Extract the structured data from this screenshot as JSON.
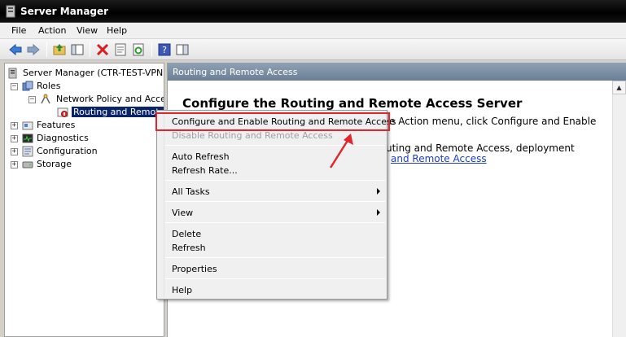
{
  "window": {
    "title": "Server Manager"
  },
  "menubar": {
    "items": [
      "File",
      "Action",
      "View",
      "Help"
    ]
  },
  "tree": {
    "root": "Server Manager (CTR-TEST-VPN)",
    "roles": "Roles",
    "npa": "Network Policy and Access",
    "rra": "Routing and Remote Ac",
    "features": "Features",
    "diagnostics": "Diagnostics",
    "configuration": "Configuration",
    "storage": "Storage"
  },
  "right": {
    "header": "Routing and Remote Access",
    "heading": "Configure the Routing and Remote Access Server",
    "line1": "e Action menu, click Configure and Enable",
    "line2": "uting and Remote Access, deployment",
    "link": "and Remote Access"
  },
  "context_menu": {
    "configure": "Configure and Enable Routing and Remote Access",
    "disable": "Disable Routing and Remote Access",
    "auto_refresh": "Auto Refresh",
    "refresh_rate": "Refresh Rate...",
    "all_tasks": "All Tasks",
    "view": "View",
    "delete": "Delete",
    "refresh": "Refresh",
    "properties": "Properties",
    "help": "Help"
  },
  "colors": {
    "highlight": "#e0282c",
    "selection": "#0a246a",
    "link": "#1a3ec9"
  }
}
